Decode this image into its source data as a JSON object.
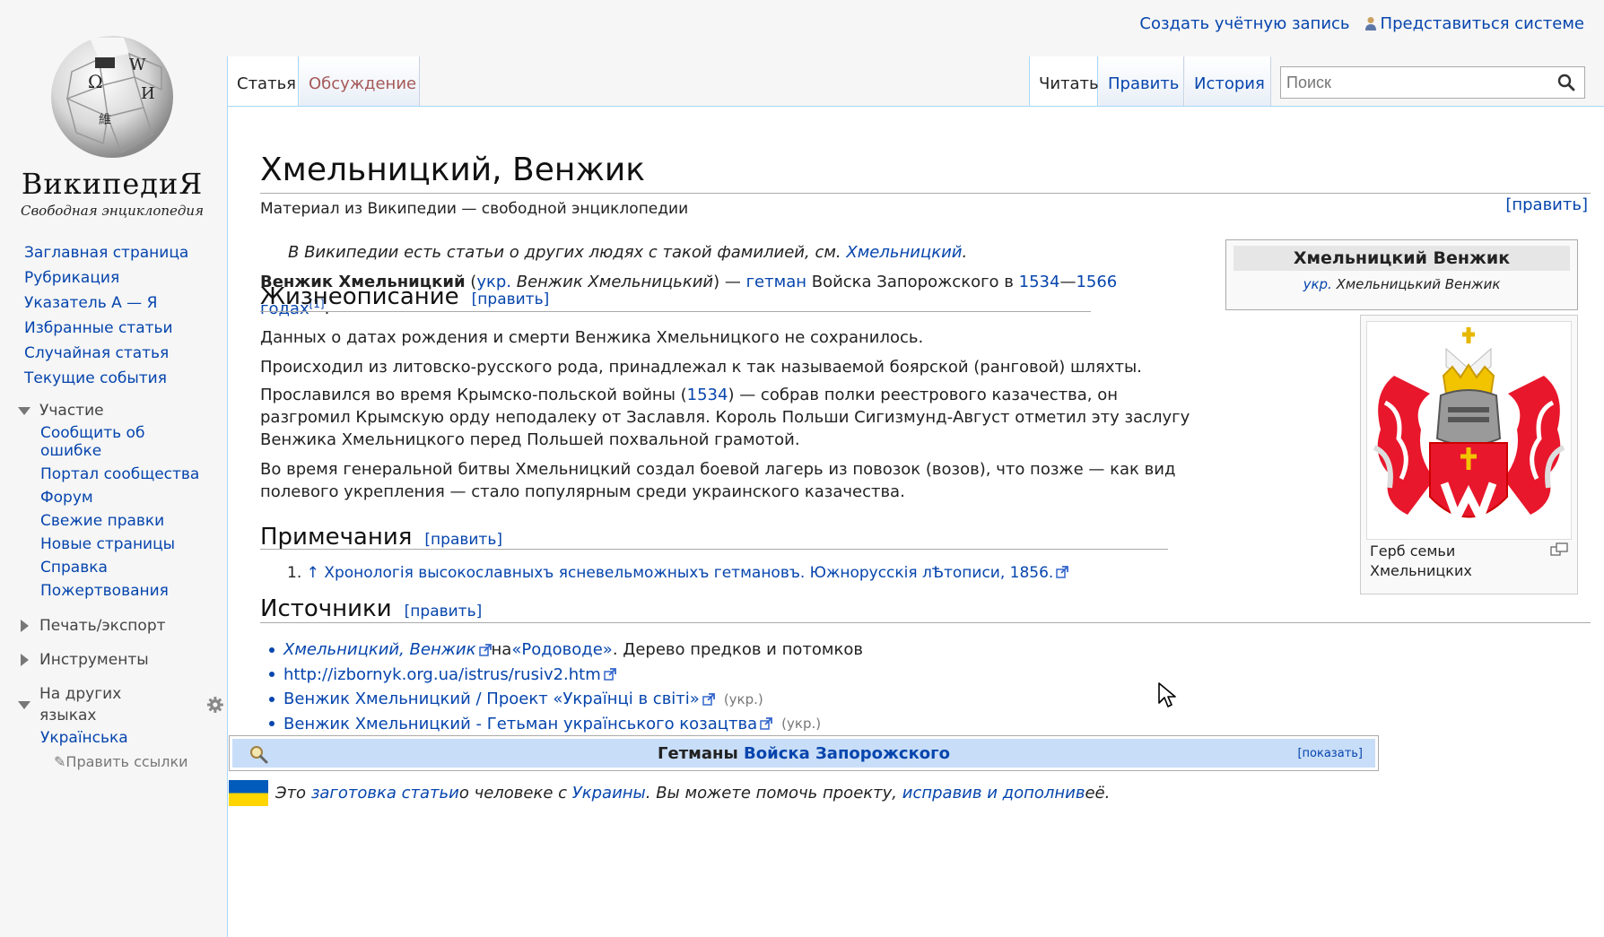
{
  "personal": {
    "create_account": "Создать учётную запись",
    "login": "Представиться системе"
  },
  "logo": {
    "wordmark": "ВикипедиЯ",
    "tagline": "Свободная энциклопедия",
    "globe_glyphs": [
      "Ω",
      "W",
      "И",
      "維"
    ]
  },
  "sidebar": {
    "main_items": [
      "Заглавная страница",
      "Рубрикация",
      "Указатель А — Я",
      "Избранные статьи",
      "Случайная статья",
      "Текущие события"
    ],
    "participation_heading": "Участие",
    "participation_items": [
      "Сообщить об ошибке",
      "Портал сообщества",
      "Форум",
      "Свежие правки",
      "Новые страницы",
      "Справка",
      "Пожертвования"
    ],
    "print_heading": "Печать/экспорт",
    "tools_heading": "Инструменты",
    "languages_heading": "На других языках",
    "language_ukrainian": "Українська",
    "edit_links": "Править ссылки"
  },
  "tabs": {
    "article": "Статья",
    "talk": "Обсуждение",
    "read": "Читать",
    "edit": "Править",
    "history": "История"
  },
  "search": {
    "placeholder": "Поиск"
  },
  "article": {
    "title": "Хмельницкий, Венжик",
    "site_sub": "Материал из Википедии — свободной энциклопедии",
    "edit_top": "[править]",
    "hatnote_prefix": "В Википедии есть статьи о других людях с такой фамилией, см. ",
    "hatnote_link": "Хмельницкий",
    "hatnote_suffix": ".",
    "lead": {
      "name": "Венжик Хмельницкий",
      "paren_open": " (",
      "lang": "укр.",
      "native": " Венжик Хмельницький",
      "paren_close": ") — ",
      "hetman": "гетман",
      "rest": " Войска Запорожского в ",
      "year1": "1534",
      "dash": "—",
      "year2": "1566 годах",
      "ref": "[1]",
      "end": "."
    },
    "sections": {
      "bio": "Жизнеописание",
      "notes": "Примечания",
      "sources": "Источники",
      "edit_label": "[править]"
    },
    "bio_paragraphs": {
      "p1": "Данных о датах рождения и смерти Венжика Хмельницкого не сохранилось.",
      "p2": "Происходил из литовско-русского рода, принадлежал к так называемой боярской (ранговой) шляхты.",
      "p3_a": "Прославился во время Крымско-польской войны (",
      "p3_link": "1534",
      "p3_b": ") — собрав полки реестрового казачества, он разгромил Крымскую орду неподалеку от Заславля. Король Польши Сигизмунд-Август отметил эту заслугу Венжика Хмельницкого перед Польшей похвальной грамотой.",
      "p4": "Во время генеральной битвы Хмельницкий создал боевой лагерь из повозок (возов), что позже — как вид полевого укрепления — стало популярным среди украинского казачества."
    },
    "notes": {
      "number": "1.",
      "arrow": "↑",
      "text": "Хронологія высокославныхъ ясневельможныхъ гетмановъ. Южнорусскія лѢтописи, 1856."
    },
    "sources": [
      {
        "link": "Хмельницкий, Венжик",
        "italic": true,
        "middle": " на ",
        "link2": "«Родоводе»",
        "tail": ". Дерево предков и потомков",
        "lang": ""
      },
      {
        "link": "http://izbornyk.org.ua/istrus/rusiv2.htm",
        "italic": false,
        "middle": "",
        "link2": "",
        "tail": "",
        "lang": ""
      },
      {
        "link": "Венжик Хмельницкий / Проект «Українці в світі»",
        "italic": false,
        "middle": "",
        "link2": "",
        "tail": "",
        "lang": "(укр.)"
      },
      {
        "link": "Венжик Хмельницкий - Гетьман українського козацтва",
        "italic": false,
        "middle": "",
        "link2": "",
        "tail": "",
        "lang": "(укр.)"
      }
    ]
  },
  "infobox": {
    "title": "Хмельницкий Венжик",
    "sub_lang": "укр.",
    "sub_name": " Хмельницький Венжик",
    "caption": "Герб семьи Хмельницких"
  },
  "navbox": {
    "prefix": "Гетманы ",
    "link": "Войска Запорожского",
    "toggle": "[показать]"
  },
  "stub": {
    "t1": "Это ",
    "l1": "заготовка статьи",
    "t2": " о человеке с ",
    "l2": "Украины",
    "t3": ". Вы можете помочь проекту, ",
    "l3": "исправив и дополнив",
    "t4": " её."
  },
  "colors": {
    "link": "#0645ad",
    "content_border": "#a7d7f9",
    "navbox_bar": "#c8ddf8",
    "coat_red": "#e8172c",
    "flag_blue": "#005bbb",
    "flag_yellow": "#ffd500"
  },
  "icons": [
    "user-icon",
    "search-icon",
    "gear-icon",
    "external-link-icon",
    "magnify-icon",
    "zoom-icon",
    "pencil-icon",
    "mouse-cursor-icon"
  ]
}
